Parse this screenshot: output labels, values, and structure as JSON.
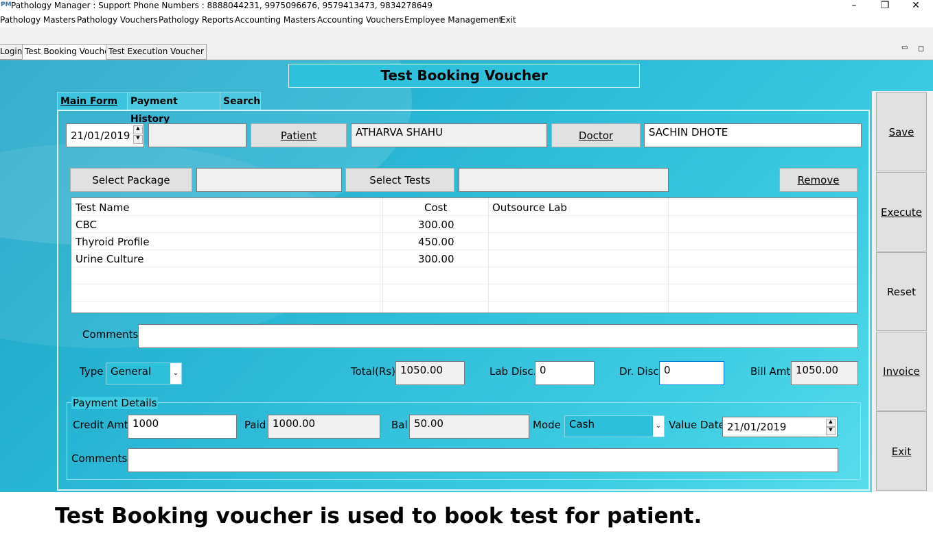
{
  "window": {
    "title": "Pathology Manager : Support Phone Numbers : 8888044231, 9975096676, 9579413473, 9834278649",
    "minimize": "–",
    "maximize": "❐",
    "close": "✕"
  },
  "menu": [
    "Pathology Masters",
    "Pathology Vouchers",
    "Pathology Reports",
    "Accounting Masters",
    "Accounting Vouchers",
    "Employee Management",
    "Exit"
  ],
  "doc_tabs": [
    "Login",
    "Test Booking Voucher",
    "Test Execution Voucher"
  ],
  "form_title": "Test Booking Voucher",
  "inner_tabs": [
    "Main Form",
    "Payment History",
    "Search"
  ],
  "header": {
    "date": "21/01/2019",
    "patient_button": "Patient",
    "patient_name": "ATHARVA SHAHU",
    "doctor_button": "Doctor",
    "doctor_name": "SACHIN DHOTE"
  },
  "selection": {
    "package_button": "Select Package",
    "package_value": "",
    "tests_button": "Select Tests",
    "tests_value": "",
    "remove_button": "Remove"
  },
  "grid": {
    "columns": [
      "Test Name",
      "Cost",
      "Outsource Lab"
    ],
    "rows": [
      {
        "name": "CBC",
        "cost": "300.00",
        "lab": ""
      },
      {
        "name": "Thyroid Profile",
        "cost": "450.00",
        "lab": ""
      },
      {
        "name": "Urine Culture",
        "cost": "300.00",
        "lab": ""
      }
    ]
  },
  "comments": {
    "label": "Comments",
    "value": ""
  },
  "totals": {
    "type_label": "Type",
    "type_value": "General",
    "total_label": "Total(Rs)",
    "total_value": "1050.00",
    "lab_disc_label": "Lab Disc.",
    "lab_disc_value": "0",
    "dr_disc_label": "Dr. Disc",
    "dr_disc_value": "0",
    "bill_label": "Bill Amt",
    "bill_value": "1050.00"
  },
  "payment": {
    "group_label": "Payment Details",
    "credit_label": "Credit Amt",
    "credit_value": "1000",
    "paid_label": "Paid",
    "paid_value": "1000.00",
    "bal_label": "Bal",
    "bal_value": "50.00",
    "mode_label": "Mode",
    "mode_value": "Cash",
    "value_date_label": "Value Date",
    "value_date": "21/01/2019",
    "comments_label": "Comments",
    "comments_value": ""
  },
  "side_buttons": [
    "Save",
    "Execute",
    "Reset",
    "Invoice",
    "Exit"
  ],
  "caption": "Test Booking voucher is used to book test for patient."
}
